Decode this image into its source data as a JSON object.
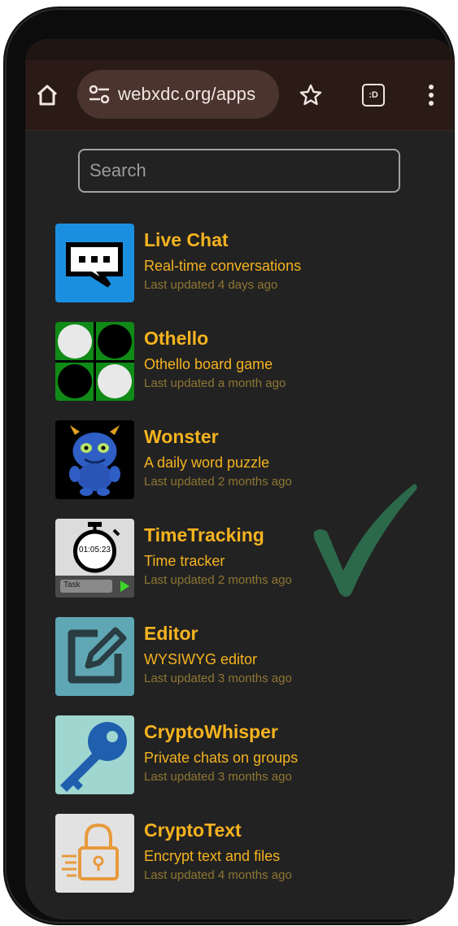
{
  "browser": {
    "url": "webxdc.org/apps",
    "tab_badge": ":D"
  },
  "search": {
    "placeholder": "Search"
  },
  "apps": [
    {
      "name": "Live Chat",
      "description": "Real-time conversations",
      "updated": "Last updated 4 days ago"
    },
    {
      "name": "Othello",
      "description": "Othello board game",
      "updated": "Last updated a month ago"
    },
    {
      "name": "Wonster",
      "description": "A daily word puzzle",
      "updated": "Last updated 2 months ago"
    },
    {
      "name": "TimeTracking",
      "description": "Time tracker",
      "updated": "Last updated 2 months ago",
      "icon_clock": "01:05:23",
      "icon_task": "Task"
    },
    {
      "name": "Editor",
      "description": "WYSIWYG editor",
      "updated": "Last updated 3 months ago"
    },
    {
      "name": "CryptoWhisper",
      "description": "Private chats on groups",
      "updated": "Last updated 3 months ago"
    },
    {
      "name": "CryptoText",
      "description": "Encrypt text and files",
      "updated": "Last updated 4 months ago"
    }
  ],
  "colors": {
    "accent": "#f5b31f",
    "muted": "#8f7632",
    "background": "#222222",
    "toolbar": "#2a1b17",
    "checkmark": "#2d6e4e"
  },
  "icons": [
    "home-icon",
    "tune-icon",
    "star-icon",
    "tab-switcher-icon",
    "more-vert-icon",
    "checkmark-overlay-icon"
  ]
}
